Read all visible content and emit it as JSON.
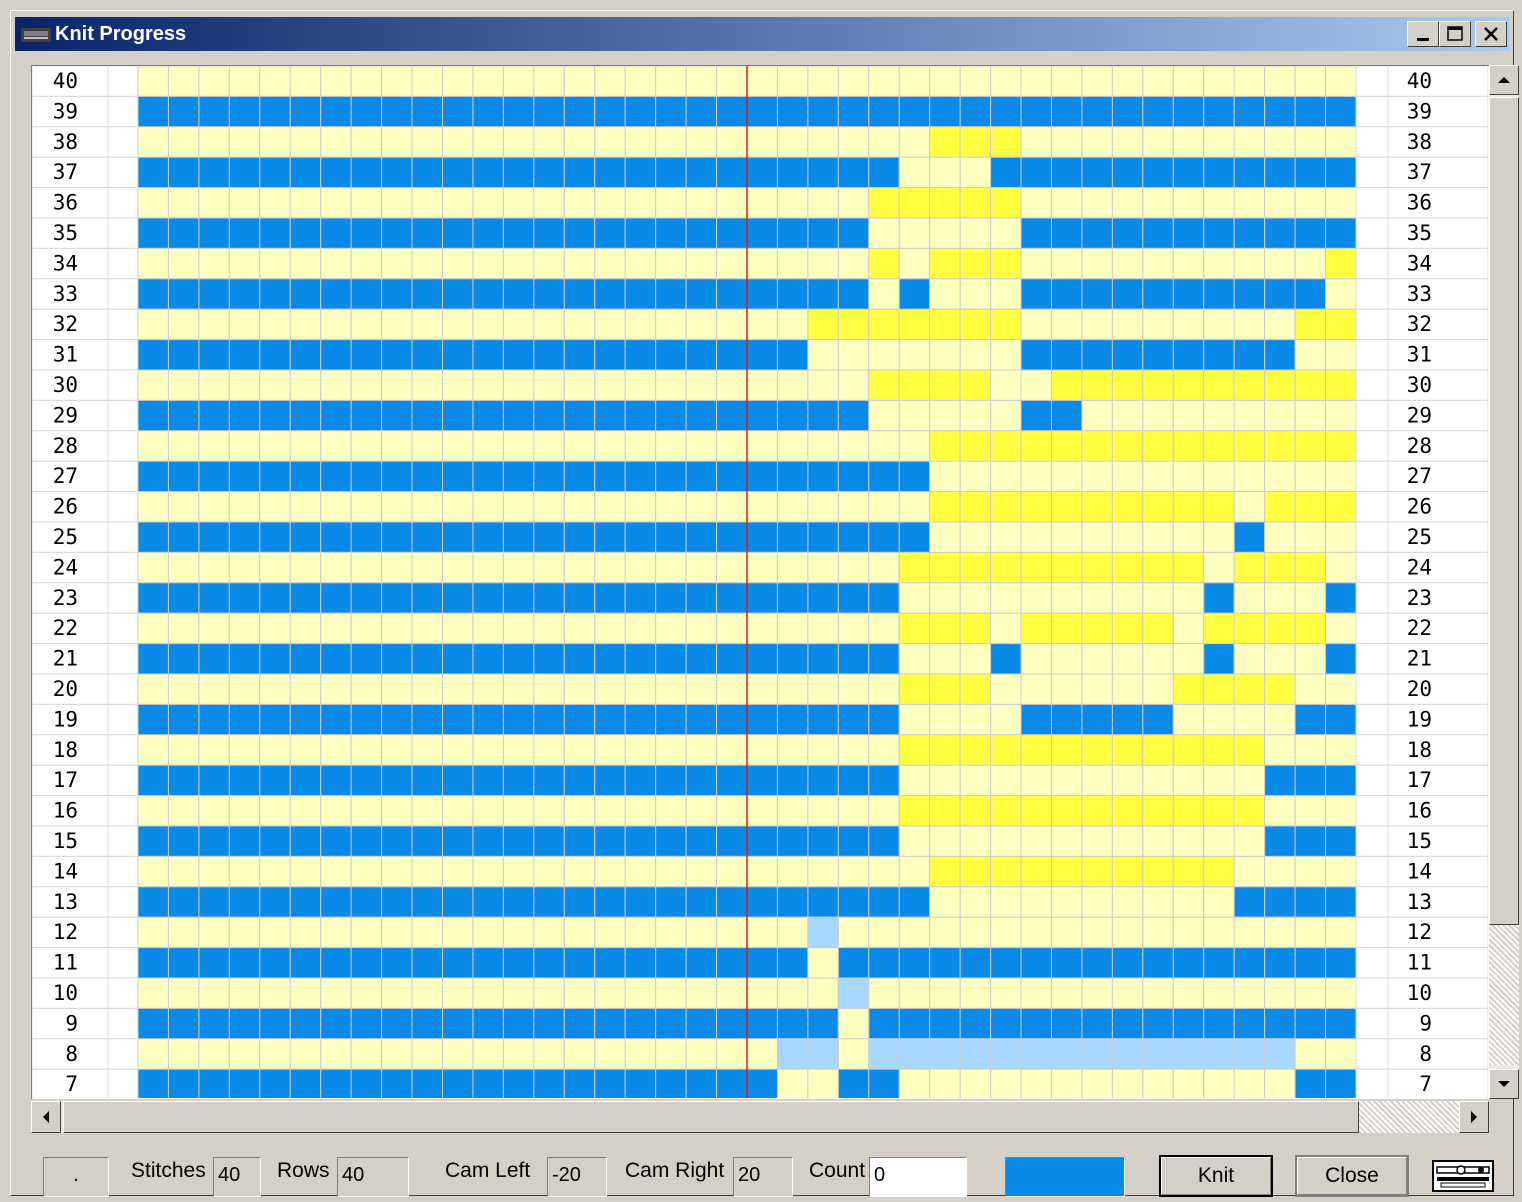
{
  "window": {
    "title": "Knit Progress"
  },
  "grid": {
    "row_numbers": [
      40,
      39,
      38,
      37,
      36,
      35,
      34,
      33,
      32,
      31,
      30,
      29,
      28,
      27,
      26,
      25,
      24,
      23,
      22,
      21,
      20,
      19,
      18,
      17,
      16,
      15,
      14,
      13,
      12,
      11,
      10,
      9,
      8,
      7
    ],
    "stitches": 40,
    "colors": {
      "background": "#ffffc0",
      "knit": "#0a8ae8",
      "pattern": "#ffff40",
      "progress": "#a8d8ff",
      "grid_line": "#cccccc",
      "center_line": "#d02020"
    },
    "rows": [
      {
        "row": 40,
        "cells": "........................................"
      },
      {
        "row": 39,
        "cells": "BBBBBBBBBBBBBBBBBBBBBBBBBBBBBBBBBBBBBBBB"
      },
      {
        "row": 38,
        "cells": "..........................YYY..........."
      },
      {
        "row": 37,
        "cells": "BBBBBBBBBBBBBBBBBBBBBBBBB...BBBBBBBBBBBB"
      },
      {
        "row": 36,
        "cells": "........................YYYYY..........."
      },
      {
        "row": 35,
        "cells": "BBBBBBBBBBBBBBBBBBBBBBBB.....BBBBBBBBBBB"
      },
      {
        "row": 34,
        "cells": "........................Y.YYY..........Y"
      },
      {
        "row": 33,
        "cells": "BBBBBBBBBBBBBBBBBBBBBBBB.B...BBBBBBBBBB."
      },
      {
        "row": 32,
        "cells": "......................YYYYYYY.........YY"
      },
      {
        "row": 31,
        "cells": "BBBBBBBBBBBBBBBBBBBBBB.......BBBBBBBBB.."
      },
      {
        "row": 30,
        "cells": "........................YYYY..YYYYYYYYYY"
      },
      {
        "row": 29,
        "cells": "BBBBBBBBBBBBBBBBBBBBBBBB.....BB........."
      },
      {
        "row": 28,
        "cells": "..........................YYYYYYYYYYYYYY"
      },
      {
        "row": 27,
        "cells": "BBBBBBBBBBBBBBBBBBBBBBBBBB.............."
      },
      {
        "row": 26,
        "cells": "..........................YYYYYYYYYY.YYY"
      },
      {
        "row": 25,
        "cells": "BBBBBBBBBBBBBBBBBBBBBBBBBB..........B...."
      },
      {
        "row": 24,
        "cells": ".........................YYYYYYYYYY.YYY."
      },
      {
        "row": 23,
        "cells": "BBBBBBBBBBBBBBBBBBBBBBBBB..........B...B"
      },
      {
        "row": 22,
        "cells": ".........................YYY.YYYYY.YYYY."
      },
      {
        "row": 21,
        "cells": "BBBBBBBBBBBBBBBBBBBBBBBBB...B......B...B"
      },
      {
        "row": 20,
        "cells": ".........................YYY......YYYY.."
      },
      {
        "row": 19,
        "cells": "BBBBBBBBBBBBBBBBBBBBBBBBB....BBBBB....BB"
      },
      {
        "row": 18,
        "cells": ".........................YYYYYYYYYYYY..."
      },
      {
        "row": 17,
        "cells": "BBBBBBBBBBBBBBBBBBBBBBBBB............BBB"
      },
      {
        "row": 16,
        "cells": ".........................YYYYYYYYYYYY..."
      },
      {
        "row": 15,
        "cells": "BBBBBBBBBBBBBBBBBBBBBBBBB............BBB"
      },
      {
        "row": 14,
        "cells": "..........................YYYYYYYYYY...."
      },
      {
        "row": 13,
        "cells": "BBBBBBBBBBBBBBBBBBBBBBBBBB..........BBBB"
      },
      {
        "row": 12,
        "cells": "......................L................."
      },
      {
        "row": 11,
        "cells": "BBBBBBBBBBBBBBBBBBBBBB.BBBBBBBBBBBBBBBBB"
      },
      {
        "row": 10,
        "cells": ".......................L................"
      },
      {
        "row": 9,
        "cells": "BBBBBBBBBBBBBBBBBBBBBBB.BBBBBBBBBBBBBBBB"
      },
      {
        "row": 8,
        "cells": ".....................LL.LLLLLLLLLLLLLL.."
      },
      {
        "row": 7,
        "cells": "BBBBBBBBBBBBBBBBBBBBB..BB.............BBB"
      }
    ]
  },
  "footer": {
    "status_box": ".",
    "stitches_label": "Stitches",
    "stitches_value": "40",
    "rows_label": "Rows",
    "rows_value": "40",
    "cam_left_label": "Cam Left",
    "cam_left_value": "-20",
    "cam_right_label": "Cam Right",
    "cam_right_value": "20",
    "count_label": "Count",
    "count_value": "0",
    "current_color": "#0a8ae8",
    "knit_button": "Knit",
    "close_button": "Close",
    "machine_icon": "knitting-machine-icon"
  }
}
